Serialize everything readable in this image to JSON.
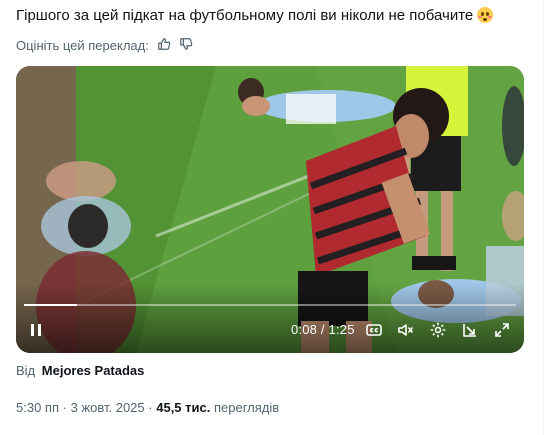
{
  "tweet": {
    "text": "Гіршого за цей підкат на футбольному полі ви ніколи не побачите",
    "emoji_icon": "flushed-face-emoji"
  },
  "translation": {
    "rate_label": "Оцініть цей переклад:",
    "thumbs_up_icon": "thumbs-up-icon",
    "thumbs_down_icon": "thumbs-down-icon"
  },
  "video": {
    "progress_fraction": 0.107,
    "time_display": "0:08 / 1:25",
    "colors": {
      "pitch": "#5e9f3e",
      "pitch_dark": "#4c8a31",
      "jersey_stripes": "#b02a2f",
      "light_blue": "#9fc7e8",
      "referee": "#d7f43c"
    },
    "controls": [
      "pause-icon",
      "captions-icon",
      "mute-icon",
      "settings-icon",
      "share-arrow-icon",
      "fullscreen-icon"
    ]
  },
  "source": {
    "prefix": "Від",
    "name": "Mejores Patadas"
  },
  "meta": {
    "time": "5:30 пп",
    "separator": "·",
    "date": "3 жовт. 2025",
    "views_count": "45,5 тис.",
    "views_label": "переглядів"
  }
}
